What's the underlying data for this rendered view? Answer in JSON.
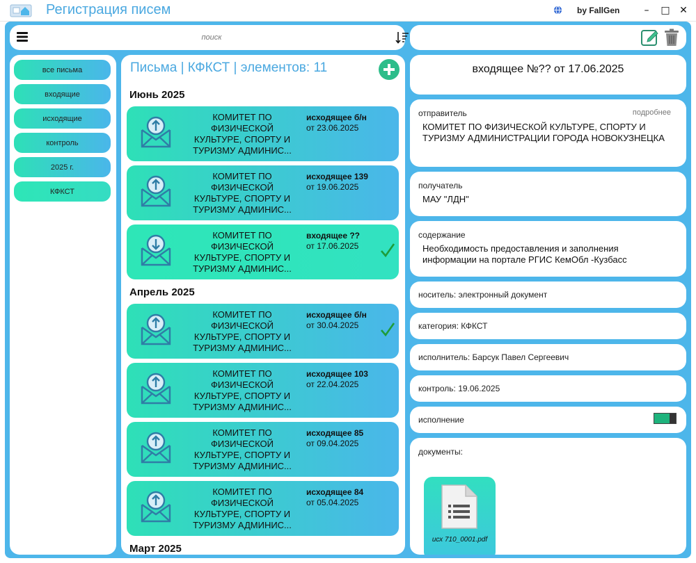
{
  "window": {
    "title": "Регистрация писем",
    "author": "by FallGen",
    "controls": {
      "minimize": "–",
      "maximize": "□",
      "close": "✕"
    }
  },
  "toolbar": {
    "search_placeholder": "поиск",
    "icons": {
      "menu": "menu-icon",
      "sort": "sort-icon",
      "edit": "edit-icon",
      "delete": "trash-icon"
    }
  },
  "filters": [
    {
      "label": "все письма",
      "active": false
    },
    {
      "label": "входящие",
      "active": false
    },
    {
      "label": "исходящие",
      "active": false
    },
    {
      "label": "контроль",
      "active": false
    },
    {
      "label": "2025 г.",
      "active": false
    },
    {
      "label": "КФКСТ",
      "active": true
    }
  ],
  "list": {
    "title": "Письма | КФКСТ | элементов: 11",
    "groups": [
      {
        "label": "Июнь 2025",
        "letters": [
          {
            "sender": "КОМИТЕТ ПО ФИЗИЧЕСКОЙ КУЛЬТУРЕ, СПОРТУ И ТУРИЗМУ АДМИНИС...",
            "direction": "исходящее б/н",
            "date": "от 23.06.2025",
            "kind": "outgoing",
            "checked": false,
            "selected": false
          },
          {
            "sender": "КОМИТЕТ ПО ФИЗИЧЕСКОЙ КУЛЬТУРЕ, СПОРТУ И ТУРИЗМУ АДМИНИС...",
            "direction": "исходящее 139",
            "date": "от 19.06.2025",
            "kind": "outgoing",
            "checked": false,
            "selected": false
          },
          {
            "sender": "КОМИТЕТ ПО ФИЗИЧЕСКОЙ КУЛЬТУРЕ, СПОРТУ И ТУРИЗМУ АДМИНИС...",
            "direction": "входящее ??",
            "date": "от 17.06.2025",
            "kind": "incoming",
            "checked": true,
            "selected": true
          }
        ]
      },
      {
        "label": "Апрель 2025",
        "letters": [
          {
            "sender": "КОМИТЕТ ПО ФИЗИЧЕСКОЙ КУЛЬТУРЕ, СПОРТУ И ТУРИЗМУ АДМИНИС...",
            "direction": "исходящее б/н",
            "date": "от 30.04.2025",
            "kind": "outgoing",
            "checked": true,
            "selected": false
          },
          {
            "sender": "КОМИТЕТ ПО ФИЗИЧЕСКОЙ КУЛЬТУРЕ, СПОРТУ И ТУРИЗМУ АДМИНИС...",
            "direction": "исходящее 103",
            "date": "от 22.04.2025",
            "kind": "outgoing",
            "checked": false,
            "selected": false
          },
          {
            "sender": "КОМИТЕТ ПО ФИЗИЧЕСКОЙ КУЛЬТУРЕ, СПОРТУ И ТУРИЗМУ АДМИНИС...",
            "direction": "исходящее 85",
            "date": "от 09.04.2025",
            "kind": "outgoing",
            "checked": false,
            "selected": false
          },
          {
            "sender": "КОМИТЕТ ПО ФИЗИЧЕСКОЙ КУЛЬТУРЕ, СПОРТУ И ТУРИЗМУ АДМИНИС...",
            "direction": "исходящее 84",
            "date": "от 05.04.2025",
            "kind": "outgoing",
            "checked": false,
            "selected": false
          }
        ]
      },
      {
        "label": "Март 2025",
        "letters": []
      }
    ]
  },
  "detail": {
    "header": "входящее №?? от 17.06.2025",
    "sender_label": "отправитель",
    "sender_more": "подробнее",
    "sender_value": "КОМИТЕТ ПО ФИЗИЧЕСКОЙ КУЛЬТУРЕ, СПОРТУ И ТУРИЗМУ АДМИНИСТРАЦИИ ГОРОДА НОВОКУЗНЕЦКА",
    "recipient_label": "получатель",
    "recipient_value": "МАУ \"ЛДН\"",
    "content_label": "содержание",
    "content_value": "Необходимость предоставления и заполнения информации на портале РГИС КемОбл -Кузбасс",
    "carrier": "носитель: электронный документ",
    "category": "категория: КФКСТ",
    "executor": "исполнитель: Барсук Павел Сергеевич",
    "control": "контроль: 19.06.2025",
    "execution_label": "исполнение",
    "execution_on": true,
    "documents_label": "документы:",
    "documents": [
      {
        "name": "исх 710_0001.pdf"
      }
    ]
  },
  "colors": {
    "accent": "#4db6ea",
    "title": "#4aa8e0",
    "gradient_start": "#2ee0b7",
    "gradient_end": "#4ab6ea",
    "add_button": "#2dbd8a",
    "check": "#1e9c3a",
    "toggle_on": "#1eb37c"
  }
}
